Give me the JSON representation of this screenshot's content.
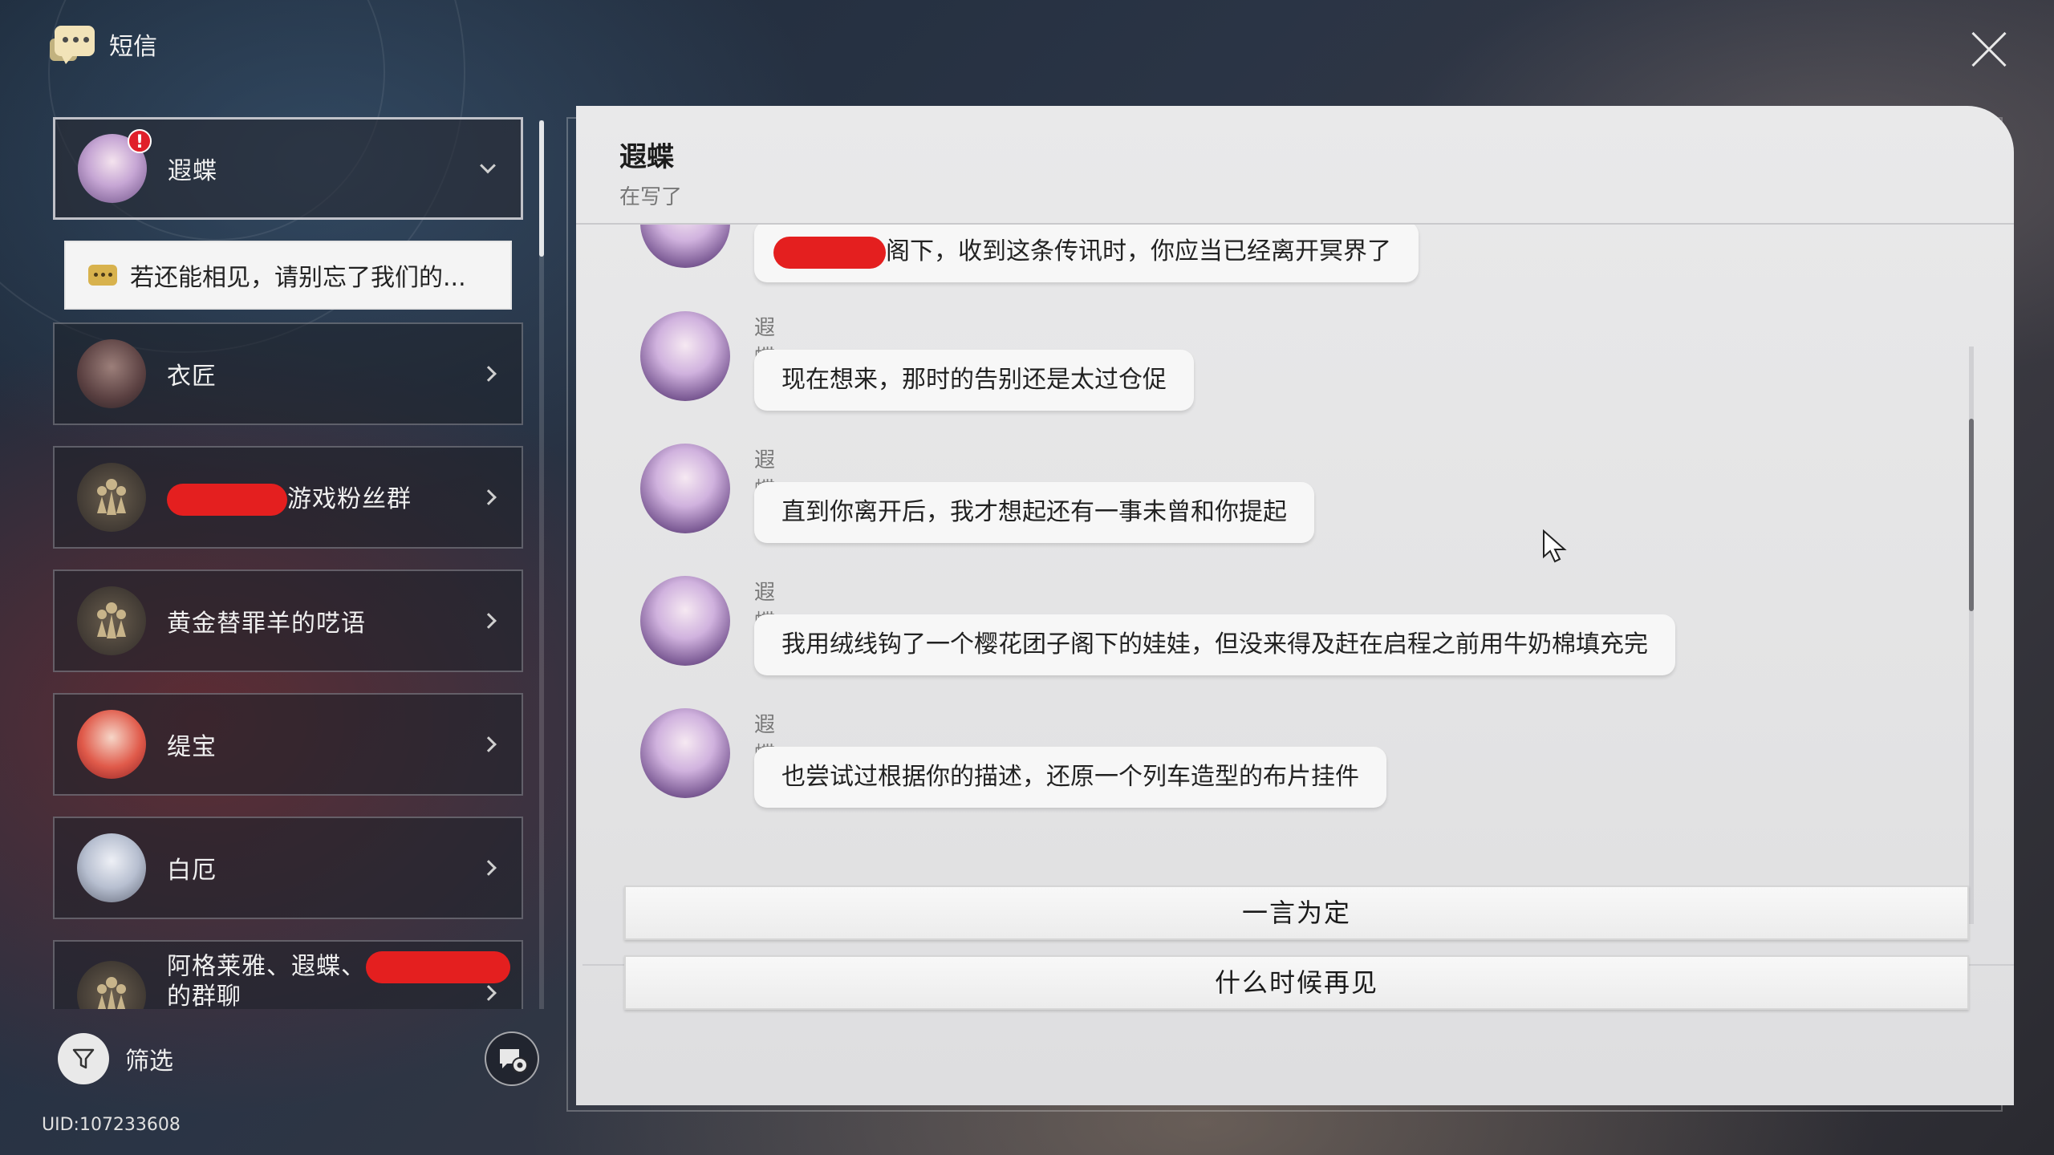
{
  "app": {
    "title": "短信",
    "uid": "UID:107233608"
  },
  "sidebar": {
    "contacts": [
      {
        "name": "遐蝶",
        "badge": "!",
        "active": true
      },
      {
        "name": "衣匠"
      },
      {
        "name_suffix": "游戏粉丝群"
      },
      {
        "name": "黄金替罪羊的呓语"
      },
      {
        "name": "缇宝"
      },
      {
        "name": "白厄"
      },
      {
        "name_prefix": "阿格莱雅、遐蝶、",
        "name_line2": "的群聊"
      }
    ],
    "preview": "若还能相见，请别忘了我们的...",
    "filter_label": "筛选"
  },
  "chat": {
    "name": "遐蝶",
    "status": "在写了",
    "messages": [
      {
        "sender": "",
        "text": "阁下，收到这条传讯时，你应当已经离开冥界了"
      },
      {
        "sender": "遐蝶",
        "text": "现在想来，那时的告别还是太过仓促"
      },
      {
        "sender": "遐蝶",
        "text": "直到你离开后，我才想起还有一事未曾和你提起"
      },
      {
        "sender": "遐蝶",
        "text": "我用绒线钩了一个樱花团子阁下的娃娃，但没来得及赶在启程之前用牛奶棉填充完"
      },
      {
        "sender": "遐蝶",
        "text": "也尝试过根据你的描述，还原一个列车造型的布片挂件"
      }
    ],
    "replies": [
      "一言为定",
      "什么时候再见"
    ]
  },
  "colors": {
    "redaction": "#e41f1f",
    "badge": "#e01f2a",
    "panel": "#e6e6e7"
  }
}
